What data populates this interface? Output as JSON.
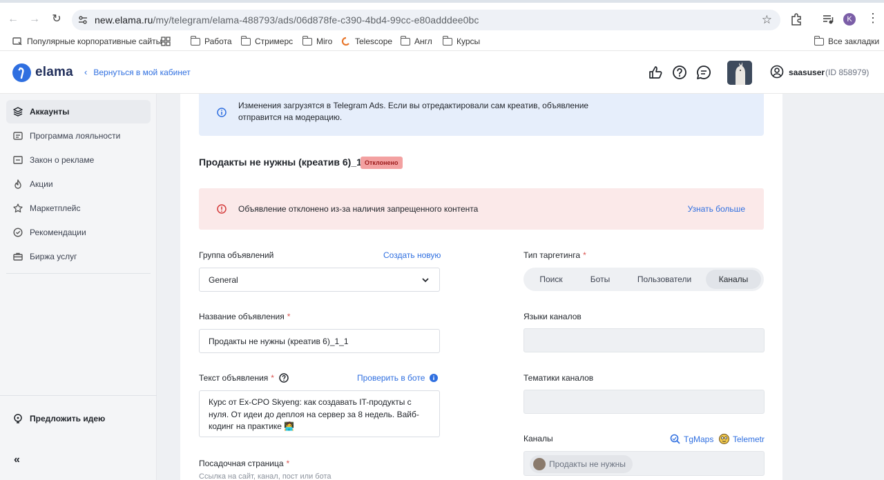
{
  "browser": {
    "url_host": "new.elama.ru",
    "url_path": "/my/telegram/elama-488793/ads/06d878fe-c390-4bd4-99cc-e80adddee0bc",
    "profile_initial": "K"
  },
  "bookmarks": {
    "items": [
      {
        "label": "Популярные корпоративные сайты",
        "icon": "site-icon"
      },
      {
        "label": "",
        "icon": "grid-icon"
      },
      {
        "label": "Работа",
        "icon": "folder-icon"
      },
      {
        "label": "Стримерс",
        "icon": "folder-icon"
      },
      {
        "label": "Miro",
        "icon": "folder-icon"
      },
      {
        "label": "Telescope",
        "icon": "telescope-icon"
      },
      {
        "label": "Англ",
        "icon": "folder-icon"
      },
      {
        "label": "Курсы",
        "icon": "folder-icon"
      }
    ],
    "all_bookmarks": "Все закладки"
  },
  "header": {
    "logo": "elama",
    "back_label": "Вернуться в мой кабинет",
    "user_name": "saasuser",
    "user_id": "(ID 858979)"
  },
  "sidebar": {
    "items": [
      {
        "label": "Аккаунты",
        "icon": "layers-icon",
        "active": true
      },
      {
        "label": "Программа лояльности",
        "icon": "loyalty-icon"
      },
      {
        "label": "Закон о рекламе",
        "icon": "law-icon"
      },
      {
        "label": "Акции",
        "icon": "flame-icon"
      },
      {
        "label": "Маркетплейс",
        "icon": "star-icon"
      },
      {
        "label": "Рекомендации",
        "icon": "check-circle-icon"
      },
      {
        "label": "Биржа услуг",
        "icon": "briefcase-icon"
      }
    ],
    "suggest_idea": "Предложить идею",
    "collapse": "«"
  },
  "info": {
    "text": "Изменения загрузятся в Telegram Ads. Если вы отредактировали сам креатив, объявление отправится на модерацию."
  },
  "ad": {
    "title": "Продакты не нужны (креатив 6)_1_1",
    "status": "Отклонено"
  },
  "error": {
    "text": "Объявление отклонено из-за наличия запрещенного контента",
    "link": "Узнать больше"
  },
  "form": {
    "group_label": "Группа объявлений",
    "group_create": "Создать новую",
    "group_value": "General",
    "name_label": "Название объявления",
    "name_value": "Продакты не нужны (креатив 6)_1_1",
    "text_label": "Текст объявления",
    "check_bot": "Проверить в боте",
    "text_value": "Курс от Ex-CPO Skyeng: как создавать IT-продукты с нуля. От идеи до деплоя на сервер за 8 недель. Вайб-кодинг на практике 🧑‍💻",
    "landing_label": "Посадочная страница",
    "landing_hint": "Ссылка на сайт, канал, пост или бота",
    "targeting_label": "Тип таргетинга",
    "targeting_options": [
      "Поиск",
      "Боты",
      "Пользователи",
      "Каналы"
    ],
    "targeting_selected": "Каналы",
    "languages_label": "Языки каналов",
    "topics_label": "Тематики каналов",
    "channels_label": "Каналы",
    "tgmaps": "TgMaps",
    "telemetr": "Telemetr",
    "channel_chip": "Продакты не нужны"
  },
  "required_mark": "*"
}
